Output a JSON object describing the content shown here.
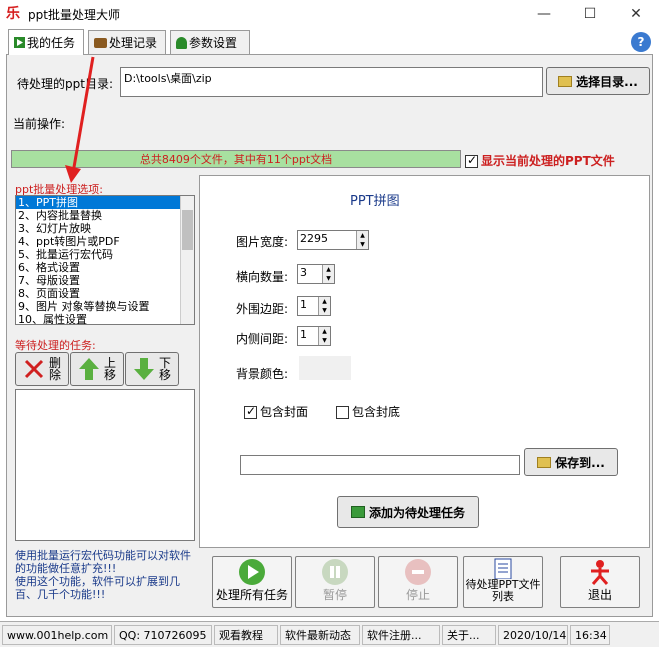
{
  "window": {
    "title": "ppt批量处理大师",
    "app_icon_glyph": "乐",
    "minimize": "—",
    "maximize": "☐",
    "close": "✕"
  },
  "tabs": [
    {
      "label": "我的任务"
    },
    {
      "label": "处理记录"
    },
    {
      "label": "参数设置"
    }
  ],
  "help_glyph": "?",
  "top": {
    "dir_label": "待处理的ppt目录:",
    "dir_value": "D:\\tools\\桌面\\zip",
    "choose_dir_button": "选择目录...",
    "current_op_label": "当前操作:",
    "progress_text": "总共8409个文件，其中有11个ppt文档",
    "show_current_label": "显示当前处理的PPT文件"
  },
  "options": {
    "label": "ppt批量处理选项:",
    "items": [
      "1、PPT拼图",
      "2、内容批量替换",
      "3、幻灯片放映",
      "4、ppt转图片或PDF",
      "5、批量运行宏代码",
      "6、格式设置",
      "7、母版设置",
      "8、页面设置",
      "9、图片 对象等替换与设置",
      "10、属性设置"
    ]
  },
  "pending": {
    "label": "等待处理的任务:",
    "delete_button": "删\n除",
    "up_button": "上\n移",
    "down_button": "下\n移"
  },
  "tip": "使用批量运行宏代码功能可以对软件的功能做任意扩充!!!\n使用这个功能，软件可以扩展到几百、几千个功能!!!",
  "settings": {
    "title": "PPT拼图",
    "width_label": "图片宽度:",
    "width_value": "2295",
    "hcount_label": "横向数量:",
    "hcount_value": "3",
    "outer_label": "外围边距:",
    "outer_value": "1",
    "inner_label": "内侧间距:",
    "inner_value": "1",
    "bg_label": "背景颜色:",
    "include_cover_label": "包含封面",
    "include_back_label": "包含封底",
    "save_path_value": "",
    "save_button": "保存到...",
    "add_task_button": "添加为待处理任务"
  },
  "actions": {
    "process_all": "处理所有任务",
    "pause": "暂停",
    "stop": "停止",
    "ppt_list": "待处理PPT文件列表",
    "exit": "退出"
  },
  "statusbar": {
    "site": "www.001help.com",
    "qq": "QQ:  710726095",
    "tutorial": "观看教程",
    "news": "软件最新动态",
    "register": "软件注册...",
    "about": "关于...",
    "date": "2020/10/14",
    "time": "16:34"
  },
  "colors": {
    "selection": "#0078d7",
    "progress_fill": "#a8e0a0",
    "accent_red": "#cc2020",
    "title_blue": "#1a3a8a"
  }
}
